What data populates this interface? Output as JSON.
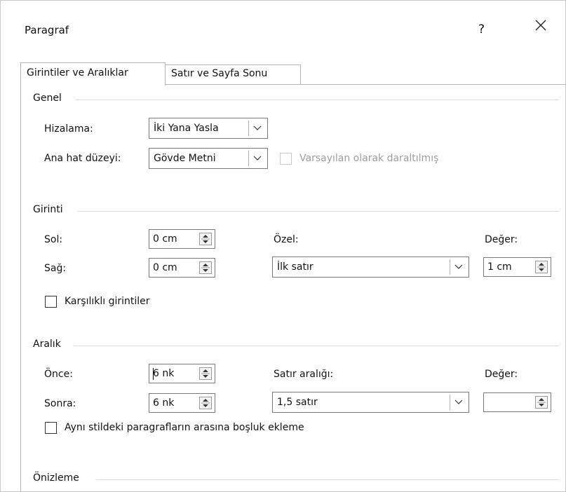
{
  "dialog": {
    "title": "Paragraf",
    "help_label": "?",
    "close_label": "✕"
  },
  "tabs": [
    {
      "label": "Girintiler ve Aralıklar",
      "selected": true
    },
    {
      "label": "Satır ve Sayfa Sonu",
      "selected": false
    }
  ],
  "general": {
    "heading": "Genel",
    "alignment_label": "Hizalama:",
    "alignment_value": "İki Yana Yasla",
    "outline_label": "Ana hat düzeyi:",
    "outline_value": "Gövde Metni",
    "collapsed_label": "Varsayılan olarak daraltılmış",
    "collapsed_checked": false,
    "collapsed_enabled": false
  },
  "indent": {
    "heading": "Girinti",
    "left_label": "Sol:",
    "left_value": "0 cm",
    "right_label": "Sağ:",
    "right_value": "0 cm",
    "special_label": "Özel:",
    "special_value": "İlk satır",
    "by_label": "Değer:",
    "by_value": "1 cm",
    "mirror_label": "Karşılıklı girintiler",
    "mirror_checked": false
  },
  "spacing": {
    "heading": "Aralık",
    "before_label": "Önce:",
    "before_value": "6 nk",
    "after_label": "Sonra:",
    "after_value": "6 nk",
    "line_spacing_label": "Satır aralığı:",
    "line_spacing_value": "1,5 satır",
    "at_label": "Değer:",
    "at_value": "",
    "no_space_label": "Aynı stildeki paragrafların arasına boşluk ekleme",
    "no_space_checked": false
  },
  "preview": {
    "heading": "Önizleme"
  },
  "icons": {
    "dropdown": "chevron-down-icon",
    "spinner": "spinner-arrows-icon",
    "close": "close-icon",
    "help": "help-icon"
  },
  "colors": {
    "border": "#7a7a7a",
    "disabled_text": "#9d9d9d",
    "group_rule": "#dadada"
  }
}
